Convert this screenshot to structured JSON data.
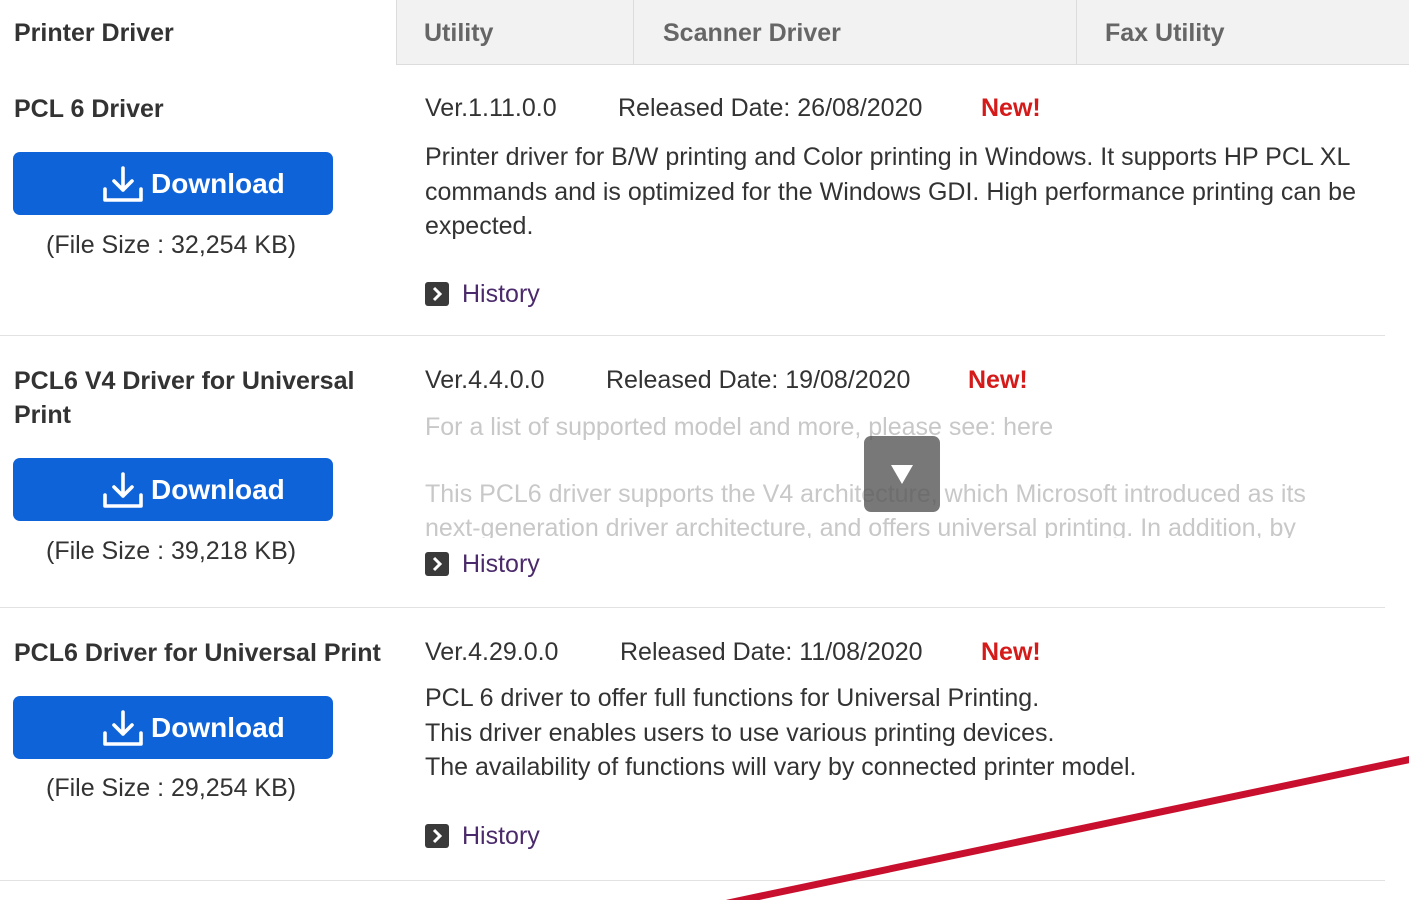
{
  "tabs": [
    {
      "label": "Printer Driver"
    },
    {
      "label": "Utility"
    },
    {
      "label": "Scanner Driver"
    },
    {
      "label": "Fax Utility"
    }
  ],
  "drivers": [
    {
      "name_lines": [
        "PCL 6 Driver"
      ],
      "download_label": "Download",
      "file_size": "(File Size : 32,254 KB)",
      "version": "Ver.1.11.0.0",
      "released": "Released Date: 26/08/2020",
      "badge": "New!",
      "description": [
        "Printer driver for B/W printing and Color printing in Windows. It supports HP PCL XL",
        "commands and is optimized for the Windows GDI. High performance printing can be",
        "expected."
      ],
      "history_label": "History"
    },
    {
      "name_lines": [
        "PCL6 V4 Driver for Universal",
        "Print"
      ],
      "download_label": "Download",
      "file_size": "(File Size : 39,218 KB)",
      "version": "Ver.4.4.0.0",
      "released": "Released Date: 19/08/2020",
      "badge": "New!",
      "description": [
        "For a list of supported model and more, please see: here",
        "",
        "This PCL6 driver supports the V4 architecture, which Microsoft introduced as its",
        "next-generation driver architecture, and offers universal printing. In addition, by"
      ],
      "history_label": "History"
    },
    {
      "name_lines": [
        "PCL6 Driver for Universal Print"
      ],
      "download_label": "Download",
      "file_size": "(File Size : 29,254 KB)",
      "version": "Ver.4.29.0.0",
      "released": "Released Date: 11/08/2020",
      "badge": "New!",
      "description": [
        "PCL 6 driver to offer full functions for Universal Printing.",
        "This driver enables users to use various printing devices.",
        "The availability of functions will vary by connected printer model."
      ],
      "history_label": "History"
    }
  ],
  "colors": {
    "download_button": "#0f63d9",
    "new_badge": "#d51a1a",
    "history_link": "#4b2a6b",
    "annotation_line": "#c8102e"
  },
  "icons": {
    "download": "download-icon",
    "history": "chevron-right-icon",
    "scroll": "triangle-down-icon"
  }
}
